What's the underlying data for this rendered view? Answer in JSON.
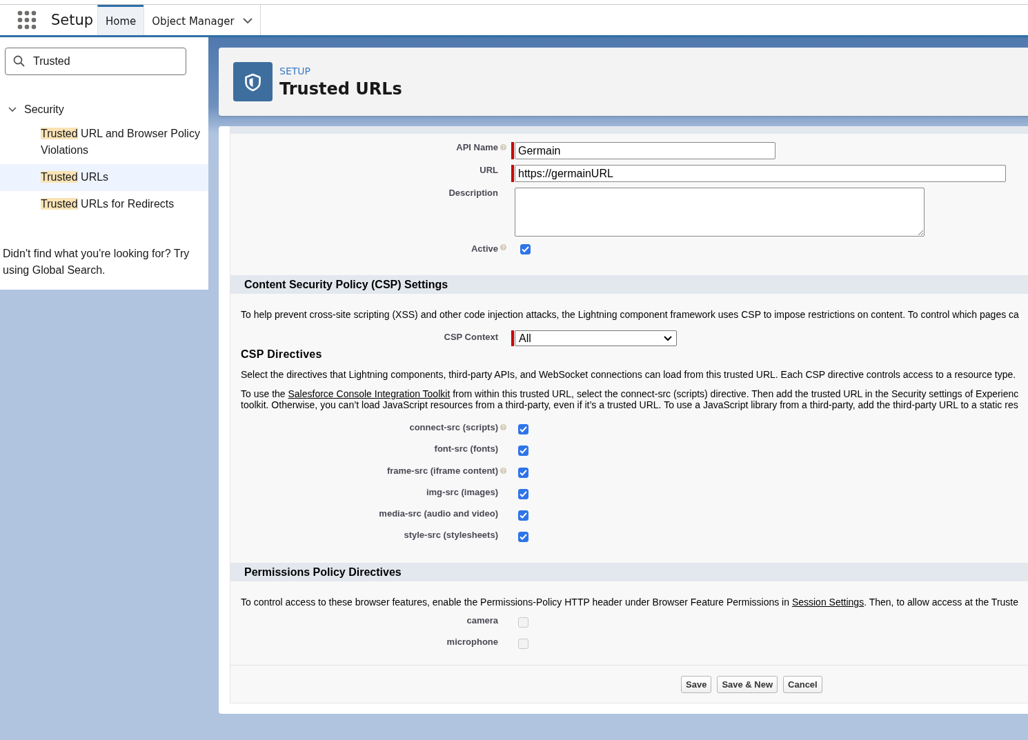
{
  "header": {
    "app_title": "Setup",
    "tabs": [
      {
        "label": "Home",
        "selected": true,
        "dropdown": false
      },
      {
        "label": "Object Manager",
        "selected": false,
        "dropdown": true
      }
    ]
  },
  "sidebar": {
    "search": {
      "value": "Trusted"
    },
    "tree": [
      {
        "label": "Security",
        "expanded": true,
        "children": [
          {
            "match": "Trusted",
            "rest": " URL and Browser Policy Violations",
            "selected": false
          },
          {
            "match": "Trusted",
            "rest": " URLs",
            "selected": true
          },
          {
            "match": "Trusted",
            "rest": " URLs for Redirects",
            "selected": false
          }
        ]
      }
    ],
    "help_text": "Didn't find what you're looking for? Try using Global Search."
  },
  "page_header": {
    "eyebrow": "SETUP",
    "title": "Trusted URLs"
  },
  "fields": [
    {
      "kind": "text",
      "label": "API Name",
      "help": true,
      "required": true,
      "value": "Germain"
    },
    {
      "kind": "url",
      "label": "URL",
      "required": true,
      "value": "https://germainURL"
    },
    {
      "kind": "textarea",
      "label": "Description"
    },
    {
      "kind": "checkbox",
      "label": "Active",
      "help": true,
      "checked": true,
      "disabled": false
    }
  ],
  "csp": {
    "heading": "Content Security Policy (CSP) Settings",
    "intro": "To help prevent cross-site scripting (XSS) and other code injection attacks, the Lightning component framework uses CSP to impose restrictions on content. To control which pages ca",
    "context": {
      "label": "CSP Context",
      "value": "All",
      "required": true
    },
    "subheading": "CSP Directives",
    "select_text": "Select the directives that Lightning components, third-party APIs, and WebSocket connections can load from this trusted URL. Each CSP directive controls access to a resource type.",
    "toolkit_lines": [
      {
        "before": "To use the ",
        "link": "Salesforce Console Integration Toolkit",
        "after": " from within this trusted URL, select the connect-src (scripts) directive. Then add the trusted URL in the Security settings of Experienc"
      },
      {
        "before": "toolkit. Otherwise, you can’t load JavaScript resources from a third-party, even if it’s a trusted URL. To use a JavaScript library from a third-party, add the third-party URL to a static res"
      }
    ],
    "directives": [
      {
        "label": "connect-src (scripts)",
        "help": true,
        "checked": true,
        "disabled": false
      },
      {
        "label": "font-src (fonts)",
        "checked": true,
        "disabled": false
      },
      {
        "label": "frame-src (iframe content)",
        "help": true,
        "checked": true,
        "disabled": false
      },
      {
        "label": "img-src (images)",
        "checked": true,
        "disabled": false
      },
      {
        "label": "media-src (audio and video)",
        "checked": true,
        "disabled": false
      },
      {
        "label": "style-src (stylesheets)",
        "checked": true,
        "disabled": false
      }
    ]
  },
  "permissions": {
    "heading": "Permissions Policy Directives",
    "intro": {
      "before": "To control access to these browser features, enable the Permissions-Policy HTTP header under Browser Feature Permissions in ",
      "link": "Session Settings",
      "after": ". Then, to allow access at the Truste"
    },
    "directives": [
      {
        "label": "camera",
        "checked": false,
        "disabled": true
      },
      {
        "label": "microphone",
        "checked": false,
        "disabled": true
      }
    ]
  },
  "buttons": [
    "Save",
    "Save & New",
    "Cancel"
  ]
}
